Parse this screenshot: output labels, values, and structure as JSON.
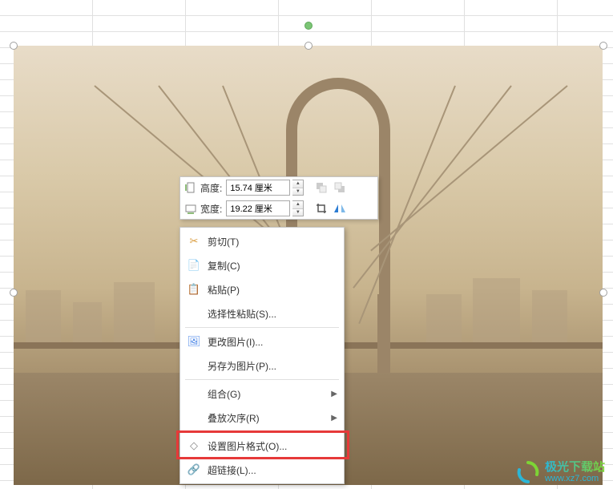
{
  "dimensions": {
    "height_label": "高度:",
    "height_value": "15.74 厘米",
    "width_label": "宽度:",
    "width_value": "19.22 厘米"
  },
  "toolbar_icons": {
    "height": "height-icon",
    "width": "width-icon",
    "bring_forward": "bring-forward-icon",
    "send_backward": "send-backward-icon",
    "crop": "crop-icon",
    "flip": "flip-icon"
  },
  "context_menu": {
    "items": [
      {
        "icon": "✂",
        "icon_name": "cut-icon",
        "label": "剪切(T)",
        "has_submenu": false
      },
      {
        "icon": "📄",
        "icon_name": "copy-icon",
        "label": "复制(C)",
        "has_submenu": false
      },
      {
        "icon": "📋",
        "icon_name": "paste-icon",
        "label": "粘贴(P)",
        "has_submenu": false
      },
      {
        "icon": "",
        "icon_name": "paste-special-icon",
        "label": "选择性粘贴(S)...",
        "has_submenu": false
      },
      {
        "sep": true
      },
      {
        "icon": "🖼",
        "icon_name": "change-image-icon",
        "label": "更改图片(I)...",
        "has_submenu": false
      },
      {
        "icon": "",
        "icon_name": "save-as-image-icon",
        "label": "另存为图片(P)...",
        "has_submenu": false
      },
      {
        "sep": true
      },
      {
        "icon": "",
        "icon_name": "group-icon",
        "label": "组合(G)",
        "has_submenu": true
      },
      {
        "icon": "",
        "icon_name": "order-icon",
        "label": "叠放次序(R)",
        "has_submenu": true
      },
      {
        "sep": true
      },
      {
        "icon": "◇",
        "icon_name": "format-picture-icon",
        "label": "设置图片格式(O)...",
        "has_submenu": false,
        "highlighted": true
      },
      {
        "icon": "🔗",
        "icon_name": "hyperlink-icon",
        "label": "超链接(L)...",
        "has_submenu": false
      }
    ]
  },
  "watermark": {
    "title": "极光下载站",
    "url": "www.xz7.com"
  }
}
